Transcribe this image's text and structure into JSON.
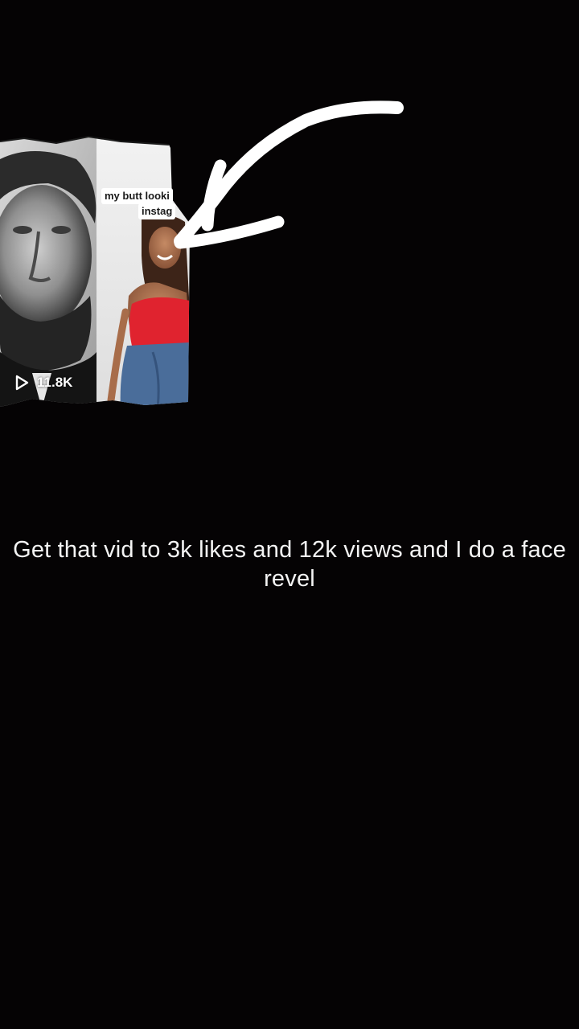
{
  "thumbnail": {
    "caption_line1": "my butt looki",
    "caption_line2": "instag",
    "views_count": "11.8K",
    "views_icon": "play-icon"
  },
  "annotation": {
    "arrow_icon": "hand-drawn-arrow-icon",
    "arrow_color": "#ffffff"
  },
  "message": {
    "text": "Get that vid to 3k likes and 12k views and I do a face revel"
  },
  "colors": {
    "background": "#050304",
    "text": "#f4f4f4",
    "top_red": "#e0232f",
    "jeans_blue": "#4a6d9a"
  }
}
